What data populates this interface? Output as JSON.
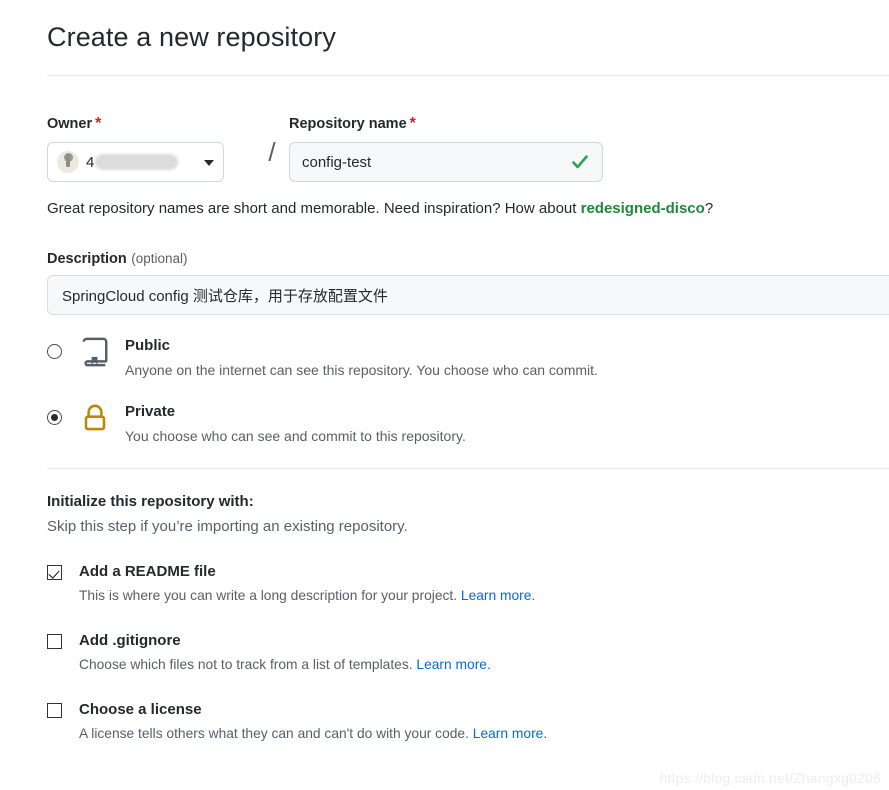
{
  "header": {
    "title": "Create a new repository"
  },
  "owner": {
    "label": "Owner",
    "required_marker": "*",
    "avatar_icon": "user-avatar-icon",
    "name_visible": "4",
    "redacted": true,
    "caret_icon": "chevron-down-icon"
  },
  "separator": "/",
  "repo_name": {
    "label": "Repository name",
    "required_marker": "*",
    "value": "config-test",
    "validation_icon": "check-icon",
    "validation_color": "#2da44e"
  },
  "hint": {
    "before": "Great repository names are short and memorable. Need inspiration? How about ",
    "suggestion": "redesigned-disco",
    "after": "?",
    "suggestion_color": "#1f883d"
  },
  "description": {
    "label": "Description",
    "optional_text": "(optional)",
    "value": "SpringCloud  config 测试仓库，用于存放配置文件"
  },
  "visibility": {
    "options": [
      {
        "id": "public",
        "title": "Public",
        "description": "Anyone on the internet can see this repository. You choose who can commit.",
        "icon": "repo-book-icon",
        "icon_color": "#57606a",
        "selected": false
      },
      {
        "id": "private",
        "title": "Private",
        "description": "You choose who can see and commit to this repository.",
        "icon": "lock-icon",
        "icon_color": "#bf8700",
        "selected": true
      }
    ]
  },
  "initialize": {
    "title": "Initialize this repository with:",
    "subtitle": "Skip this step if you’re importing an existing repository.",
    "items": [
      {
        "id": "readme",
        "label": "Add a README file",
        "description": "This is where you can write a long description for your project. ",
        "link_text": "Learn more.",
        "checked": true
      },
      {
        "id": "gitignore",
        "label": "Add .gitignore",
        "description": "Choose which files not to track from a list of templates. ",
        "link_text": "Learn more.",
        "checked": false
      },
      {
        "id": "license",
        "label": "Choose a license",
        "description": "A license tells others what they can and can't do with your code. ",
        "link_text": "Learn more.",
        "checked": false
      }
    ],
    "link_color": "#0969da"
  },
  "watermark": {
    "text": "https://blog.csdn.net/Zhangxg0206"
  }
}
